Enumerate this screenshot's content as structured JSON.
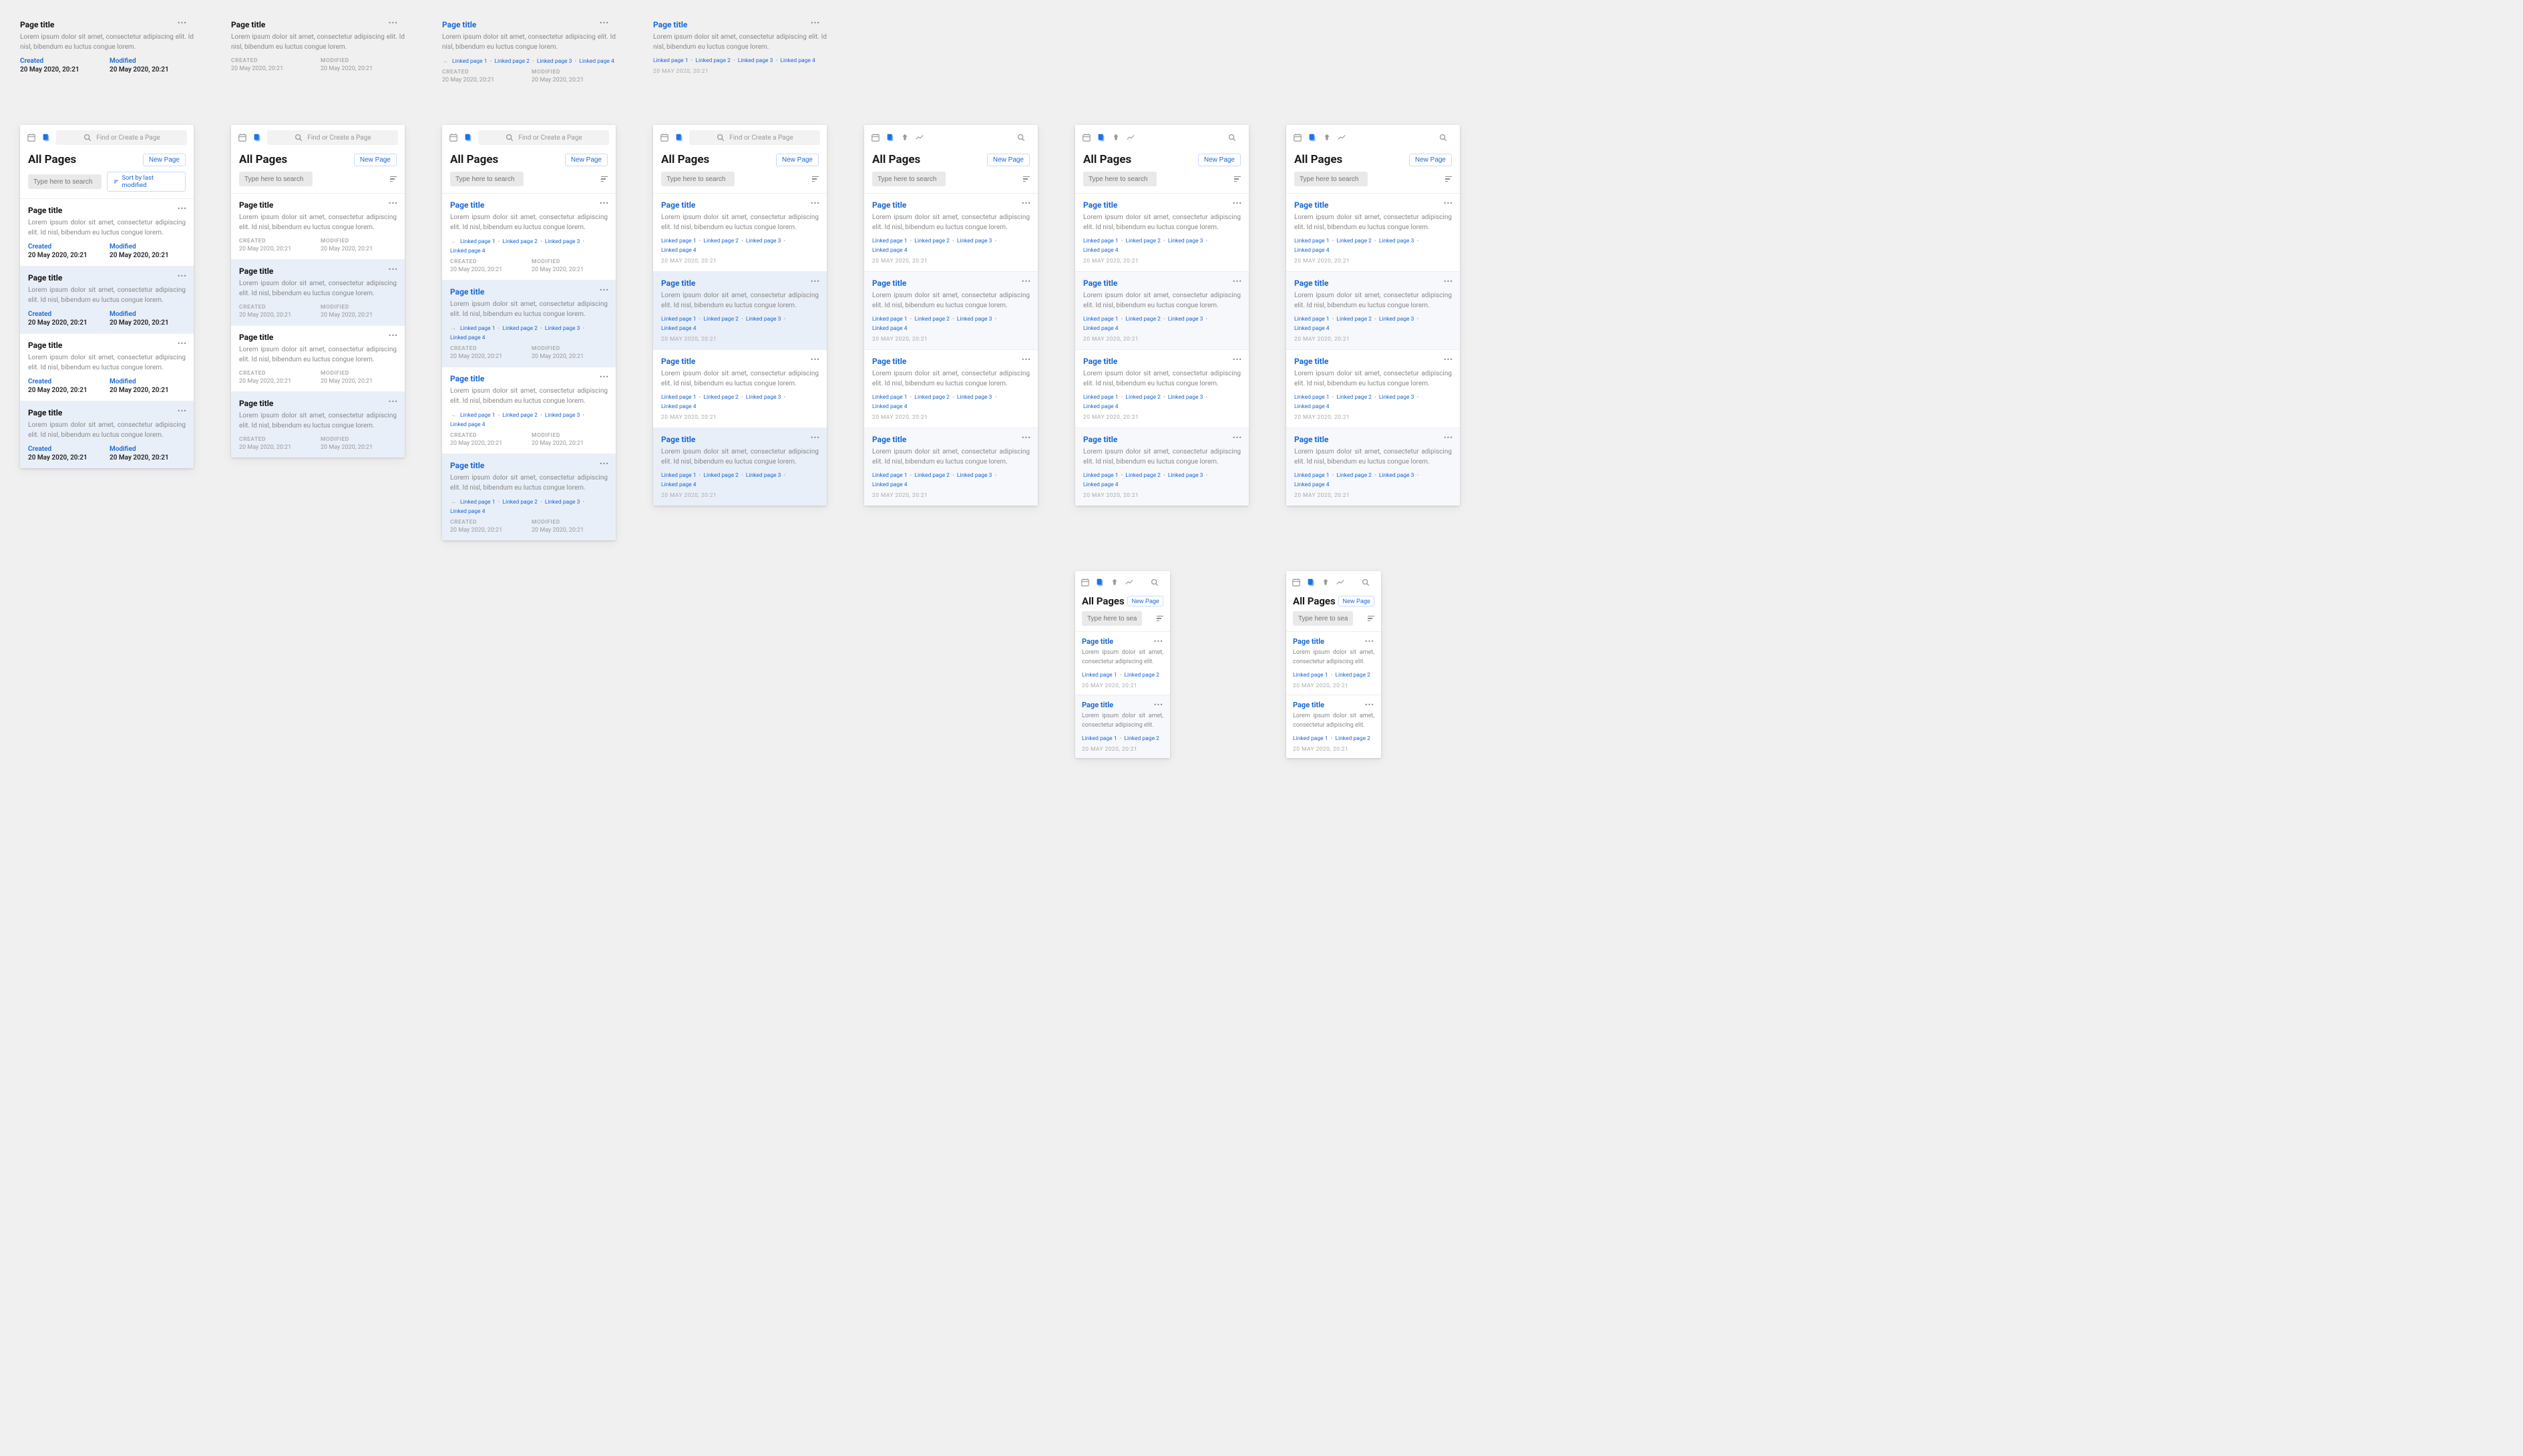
{
  "common": {
    "page_title": "Page title",
    "lorem": "Lorem ipsum dolor sit amet, consectetur adipiscing elit. Id nisl, bibendum eu luctus congue lorem.",
    "lorem_short": "Lorem ipsum dolor sit amet, consectetur adipiscing elit.",
    "created_label": "Created",
    "modified_label": "Modified",
    "created_uc": "CREATED",
    "modified_uc": "MODIFIED",
    "datetime_bold": "20 May 2020, 20:21",
    "datetime_small": "20 MAY 2020, 20:21",
    "linked1": "Linked page 1",
    "linked2": "Linked page 2",
    "linked3": "Linked page 3",
    "linked4": "Linked page 4"
  },
  "topbar": {
    "find_placeholder": "Find or Create a Page"
  },
  "header": {
    "all_pages": "All Pages",
    "new_page": "New Page",
    "search_placeholder": "Type here to search",
    "sort_label": "Sort by last modified"
  }
}
